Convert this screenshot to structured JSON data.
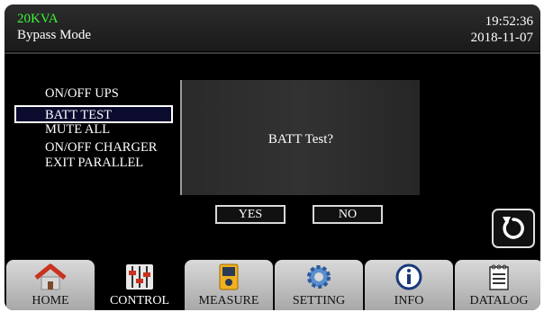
{
  "header": {
    "model": "20KVA",
    "mode": "Bypass Mode",
    "time": "19:52:36",
    "date": "2018-11-07"
  },
  "menu": {
    "items": [
      {
        "label": "ON/OFF UPS"
      },
      {
        "label": "BATT TEST"
      },
      {
        "label": "MUTE ALL"
      },
      {
        "label": "ON/OFF CHARGER"
      },
      {
        "label": "EXIT PARALLEL"
      }
    ],
    "selected": "BATT TEST"
  },
  "dialog": {
    "message": "BATT Test?",
    "yes_label": "YES",
    "no_label": "NO"
  },
  "back_icon": "undo-arrow-icon",
  "nav": {
    "tabs": [
      {
        "label": "HOME",
        "icon": "home-icon"
      },
      {
        "label": "CONTROL",
        "icon": "sliders-icon"
      },
      {
        "label": "MEASURE",
        "icon": "meter-icon"
      },
      {
        "label": "SETTING",
        "icon": "gear-icon"
      },
      {
        "label": "INFO",
        "icon": "info-icon"
      },
      {
        "label": "DATALOG",
        "icon": "calendar-log-icon"
      }
    ],
    "active": "CONTROL"
  },
  "colors": {
    "model_text": "#3df23d",
    "background": "#000000",
    "tab_gradient_top": "#d9d9d9",
    "tab_gradient_bottom": "#a8a8a8"
  }
}
